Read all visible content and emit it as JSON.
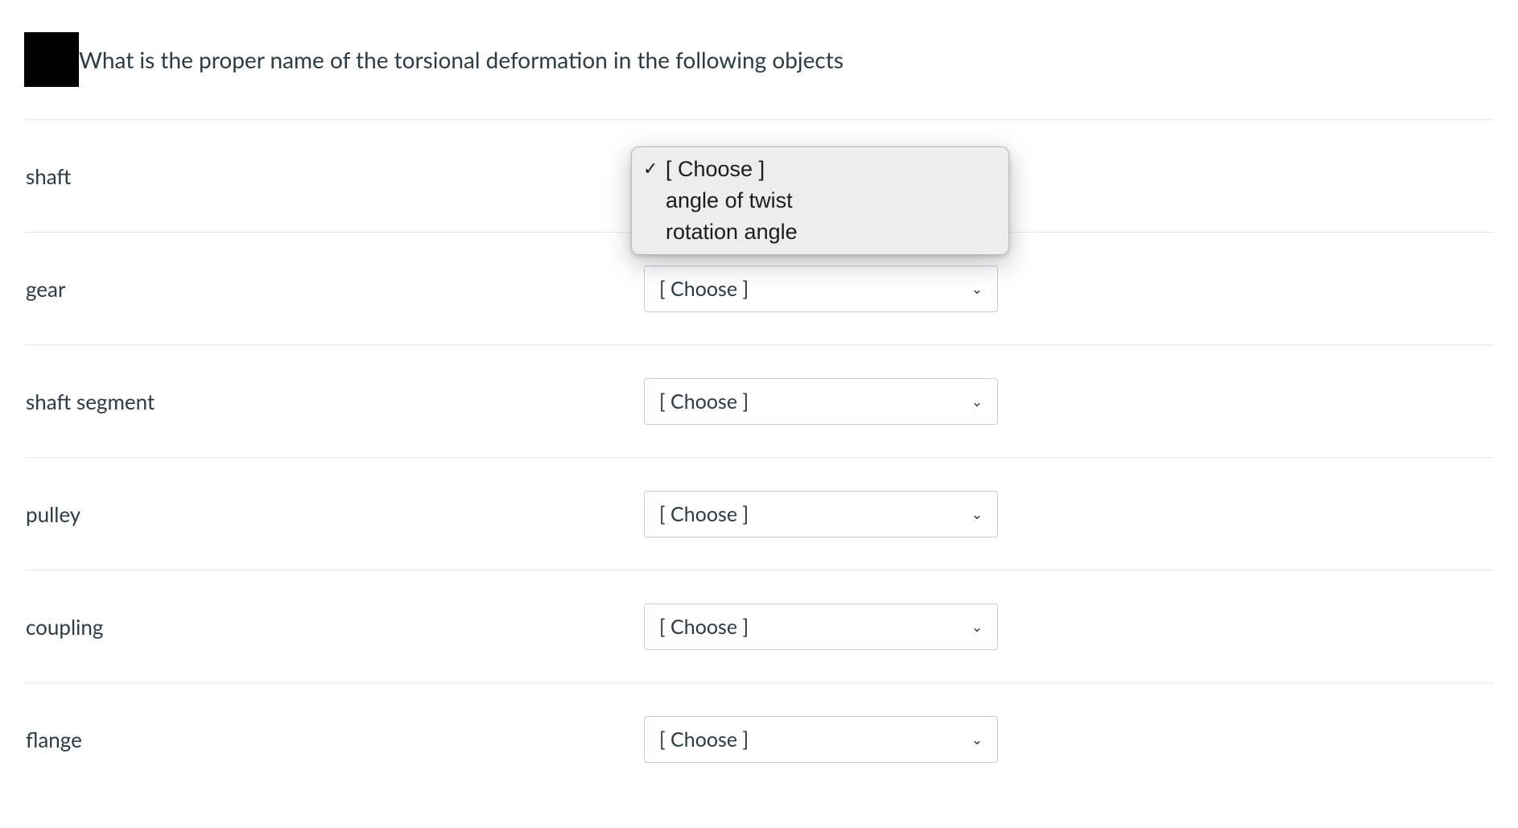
{
  "question": {
    "prompt": "What is the proper name of the torsional deformation in the following objects"
  },
  "select_placeholder": "[ Choose ]",
  "dropdown_options": {
    "opt0": "[ Choose ]",
    "opt1": "angle of twist",
    "opt2": "rotation angle"
  },
  "rows": {
    "r0": {
      "label": "shaft"
    },
    "r1": {
      "label": "gear"
    },
    "r2": {
      "label": "shaft segment"
    },
    "r3": {
      "label": "pulley"
    },
    "r4": {
      "label": "coupling"
    },
    "r5": {
      "label": "flange"
    }
  }
}
